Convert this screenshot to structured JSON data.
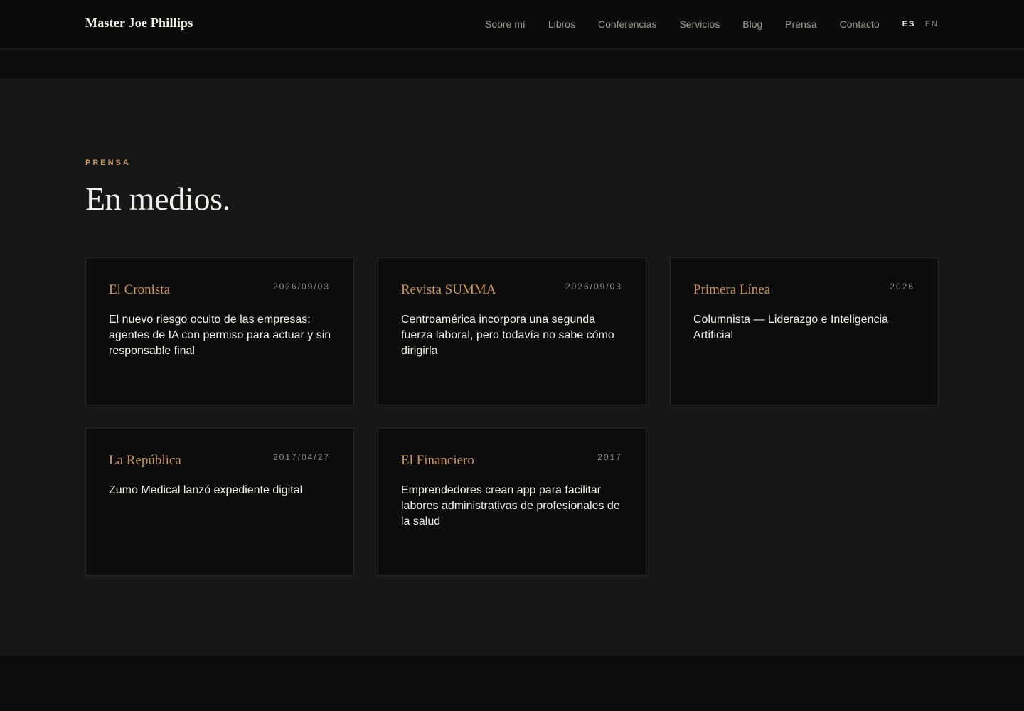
{
  "header": {
    "brand": "Master Joe Phillips",
    "nav": [
      {
        "label": "Sobre mí"
      },
      {
        "label": "Libros"
      },
      {
        "label": "Conferencias"
      },
      {
        "label": "Servicios"
      },
      {
        "label": "Blog"
      },
      {
        "label": "Prensa"
      },
      {
        "label": "Contacto"
      }
    ],
    "languages": [
      {
        "label": "ES",
        "active": true
      },
      {
        "label": "EN",
        "active": false
      }
    ],
    "lang_separator": "·"
  },
  "section": {
    "eyebrow": "PRENSA",
    "title": "En medios.",
    "cards": [
      {
        "outlet": "El Cronista",
        "date": "2026/09/03",
        "headline": "El nuevo riesgo oculto de las empresas: agentes de IA con permiso para actuar y sin responsable final"
      },
      {
        "outlet": "Revista SUMMA",
        "date": "2026/09/03",
        "headline": "Centroamérica incorpora una segunda fuerza laboral, pero todavía no sabe cómo dirigirla"
      },
      {
        "outlet": "Primera Línea",
        "date": "2026",
        "headline": "Columnista — Liderazgo e Inteligencia Artificial"
      },
      {
        "outlet": "La República",
        "date": "2017/04/27",
        "headline": "Zumo Medical lanzó expediente digital"
      },
      {
        "outlet": "El Financiero",
        "date": "2017",
        "headline": "Emprendedores crean app para facilitar labores administrativas de profesionales de la salud"
      }
    ]
  },
  "colors": {
    "accent": "#c8955a",
    "background": "#171717",
    "card": "#0c0c0c",
    "header": "#0b0b0b"
  }
}
